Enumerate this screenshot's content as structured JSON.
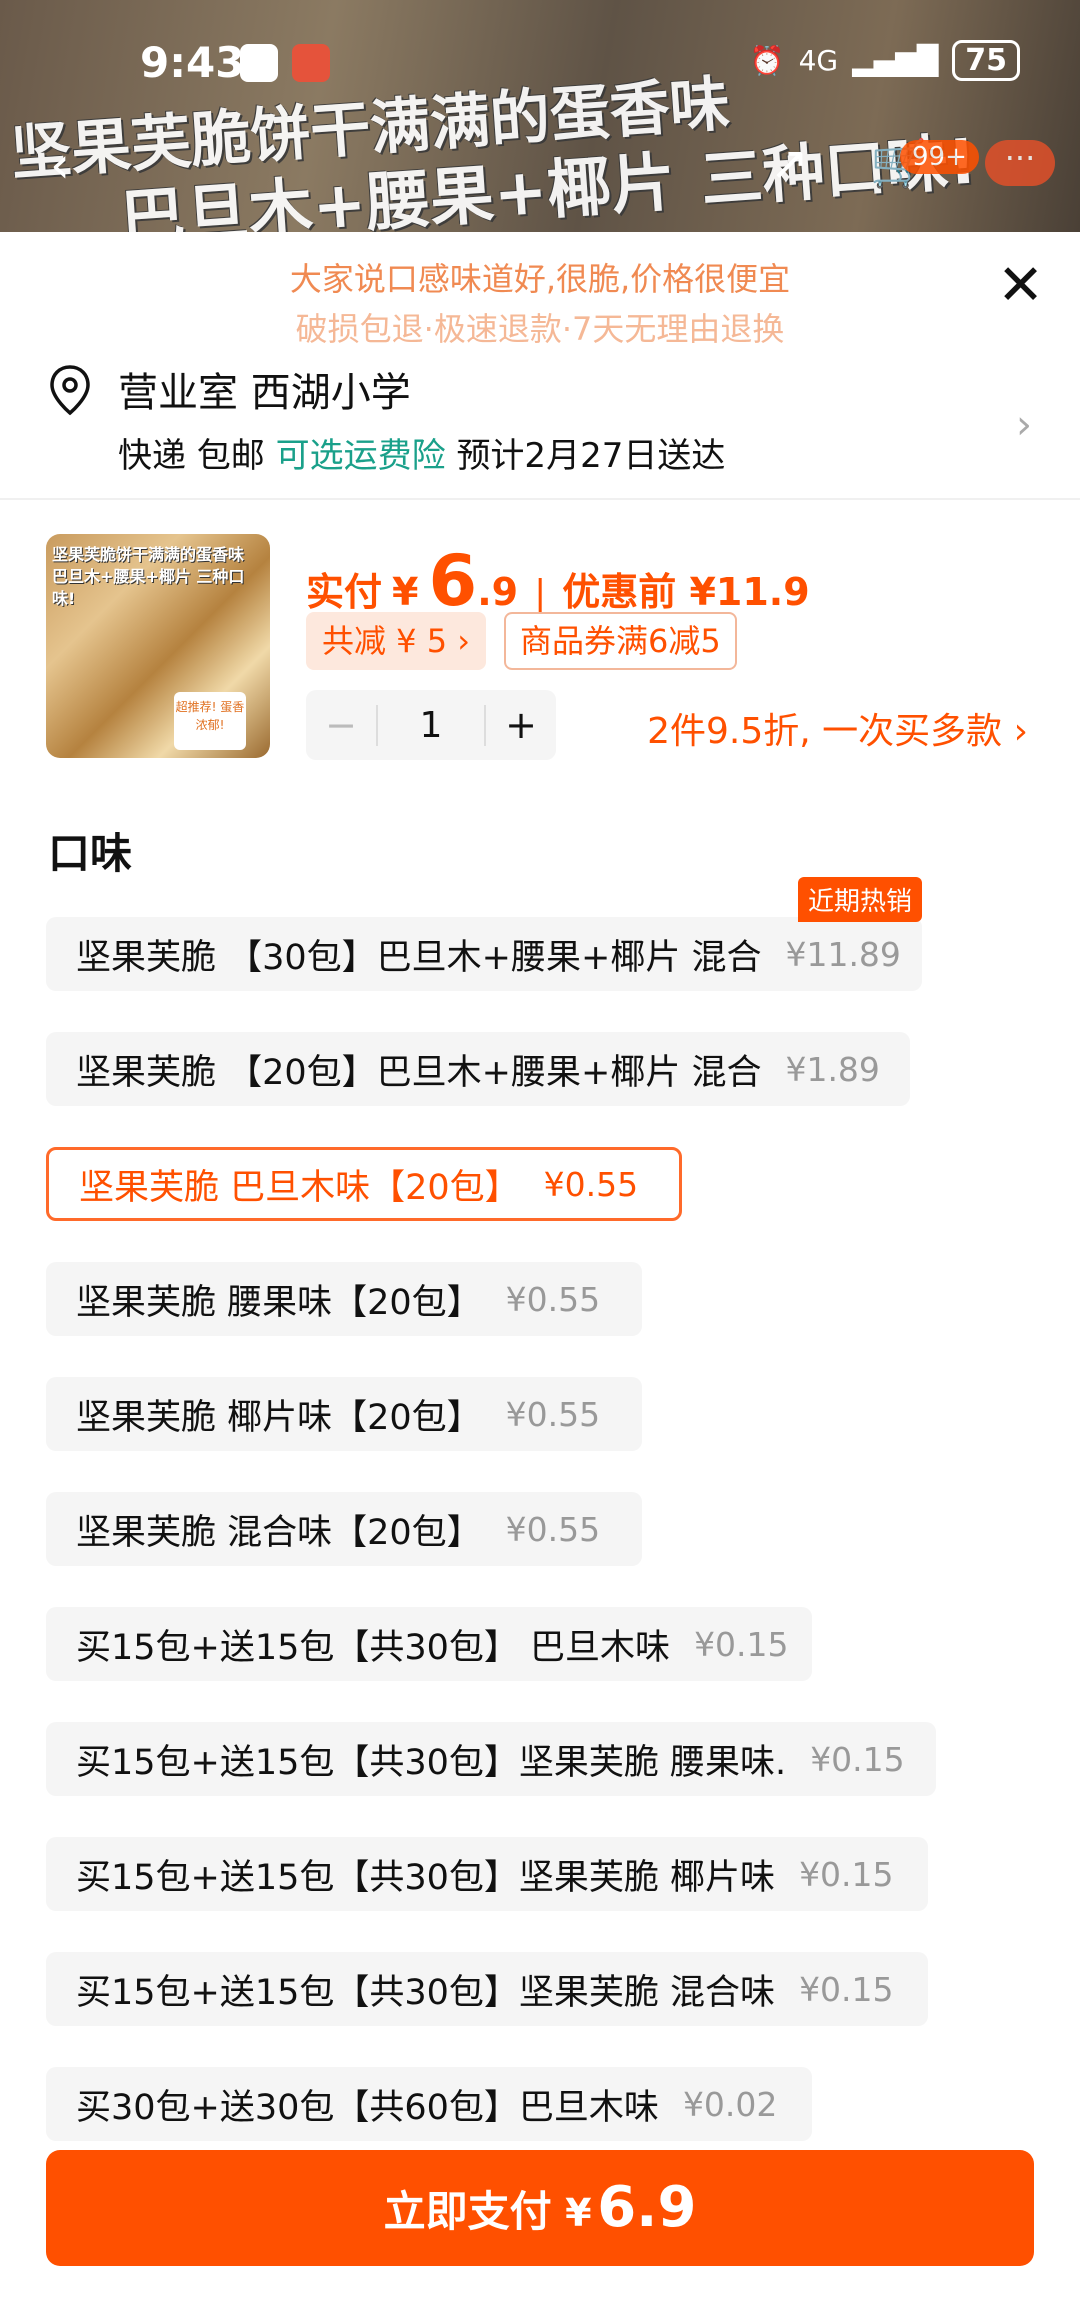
{
  "status_bar": {
    "time": "9:43",
    "network": "4G",
    "battery": "75"
  },
  "banner": {
    "line1": "坚果芙脆饼干满满的蛋香味",
    "line2": "巴旦木+腰果+椰片",
    "line3": "三种口味!"
  },
  "nav": {
    "back_icon": "‹",
    "share_icon": "↗",
    "cart_icon": "🛒",
    "cart_badge": "99+",
    "more_label": "···"
  },
  "promo": {
    "line1": "大家说口感味道好,很脆,价格很便宜",
    "line2": "破损包退·极速退款·7天无理由退换"
  },
  "address": {
    "title": "营业室 西湖小学",
    "express": "快递 包邮",
    "insurance": "可选运费险",
    "eta": "预计2月27日送达"
  },
  "product": {
    "thumb_caption": "坚果芙脆饼干满满的蛋香味 巴旦木+腰果+椰片 三种口味!",
    "thumb_sticker": "超推荐! 蛋香浓郁!",
    "price_label": "实付",
    "currency": "¥",
    "price_int": "6",
    "price_dec": ".9",
    "original_price": "优惠前 ¥11.9",
    "reduce_chip": "共减 ¥ 5 ›",
    "coupon_chip": "商品券满6减5",
    "quantity": "1",
    "minus": "−",
    "plus": "+",
    "multi_offer": "2件9.5折, 一次买多款 ›"
  },
  "section_title": "口味",
  "options": [
    {
      "name": "坚果芙脆 【30包】巴旦木+腰果+椰片 混合",
      "price": "¥11.89",
      "tag": "近期热销",
      "selected": false
    },
    {
      "name": "坚果芙脆 【20包】巴旦木+腰果+椰片 混合",
      "price": "¥1.89",
      "selected": false
    },
    {
      "name": "坚果芙脆 巴旦木味【20包】",
      "price": "¥0.55",
      "selected": true
    },
    {
      "name": "坚果芙脆 腰果味【20包】",
      "price": "¥0.55",
      "selected": false
    },
    {
      "name": "坚果芙脆 椰片味【20包】",
      "price": "¥0.55",
      "selected": false
    },
    {
      "name": "坚果芙脆 混合味【20包】",
      "price": "¥0.55",
      "selected": false
    },
    {
      "name": "买15包+送15包【共30包】 巴旦木味",
      "price": "¥0.15",
      "selected": false
    },
    {
      "name": "买15包+送15包【共30包】坚果芙脆 腰果味.",
      "price": "¥0.15",
      "selected": false
    },
    {
      "name": "买15包+送15包【共30包】坚果芙脆 椰片味",
      "price": "¥0.15",
      "selected": false
    },
    {
      "name": "买15包+送15包【共30包】坚果芙脆 混合味",
      "price": "¥0.15",
      "selected": false
    },
    {
      "name": "买30包+送30包【共60包】巴旦木味",
      "price": "¥0.02",
      "selected": false
    }
  ],
  "pay_button": {
    "label": "立即支付",
    "currency": "¥",
    "amount": "6.9"
  },
  "colors": {
    "accent": "#ff5000",
    "green": "#1aa08a"
  }
}
